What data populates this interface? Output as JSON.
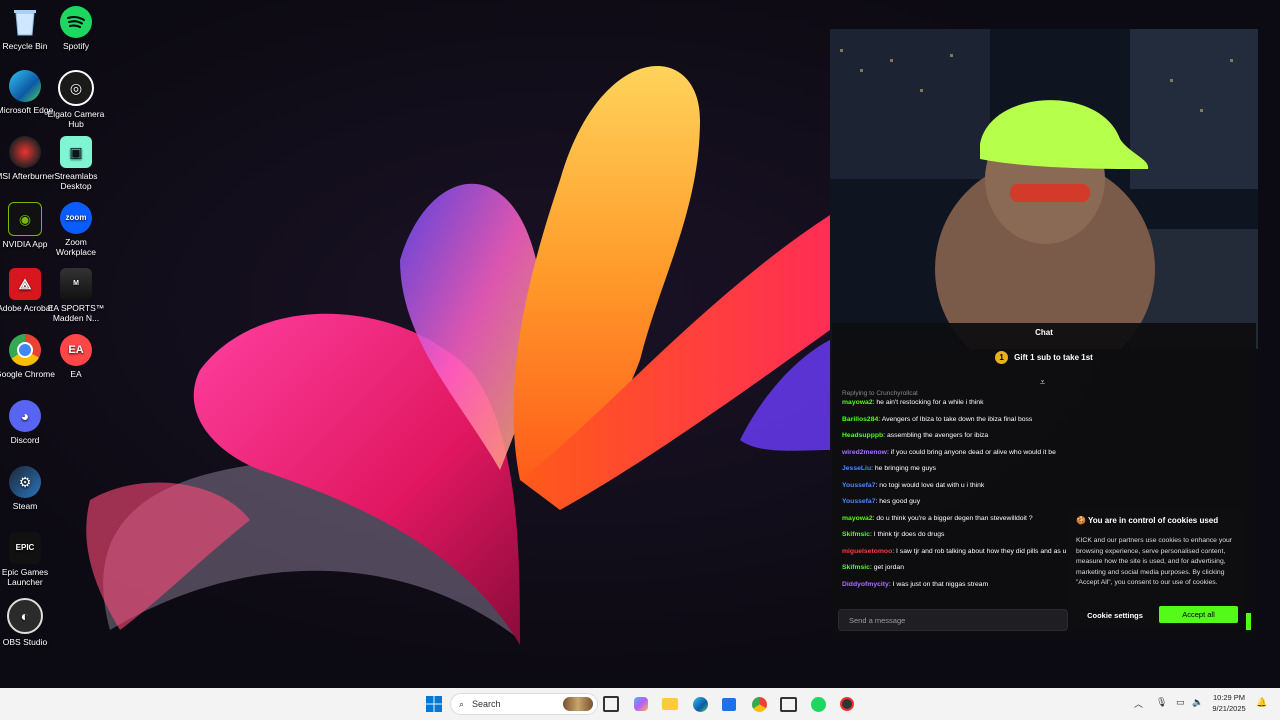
{
  "desktop": {
    "icons": [
      {
        "label": "Recycle Bin"
      },
      {
        "label": "Spotify"
      },
      {
        "label": "Microsoft Edge"
      },
      {
        "label": "Elgato Camera Hub"
      },
      {
        "label": "MSI Afterburner"
      },
      {
        "label": "Streamlabs Desktop"
      },
      {
        "label": "NVIDIA App"
      },
      {
        "label": "Zoom Workplace"
      },
      {
        "label": "Adobe Acrobat"
      },
      {
        "label": "EA SPORTS™ Madden N..."
      },
      {
        "label": "Google Chrome"
      },
      {
        "label": "EA"
      },
      {
        "label": "Discord"
      },
      {
        "label": "Steam"
      },
      {
        "label": "Epic Games Launcher"
      },
      {
        "label": "OBS Studio"
      }
    ]
  },
  "chat": {
    "title": "Chat",
    "pinned": "Gift 1 sub to take 1st",
    "reply_note": "Replying to Crunchyrollcat",
    "messages": [
      {
        "user": "mayowa2",
        "color": "#53fc18",
        "text": "he ain't restocking for a while i think"
      },
      {
        "user": "Barillos284",
        "color": "#53fc18",
        "text": "Avengers of Ibiza to take down the ibiza final boss"
      },
      {
        "user": "Headsupppb",
        "color": "#53fc18",
        "text": "assembling the avengers for ibiza"
      },
      {
        "user": "wired2menow",
        "color": "#a970ff",
        "text": "if you could bring anyone dead or alive who would it be"
      },
      {
        "user": "JesseLiu",
        "color": "#4a8cff",
        "text": "he bringing me guys"
      },
      {
        "user": "Youssefa7",
        "color": "#4a8cff",
        "text": "no togi would love dat with u i think"
      },
      {
        "user": "Youssefa7",
        "color": "#4a8cff",
        "text": "hes good guy"
      },
      {
        "user": "mayowa2",
        "color": "#53fc18",
        "text": "do u think you're a bigger degen than stevewilldoit ?"
      },
      {
        "user": "Skifmsic",
        "color": "#53fc18",
        "text": "I think tjr does do drugs"
      },
      {
        "user": "miguelsetomoo",
        "color": "#ff3b3b",
        "text": "I saw tjr and rob talking about how they did pills and as u"
      },
      {
        "user": "Skifmsic",
        "color": "#53fc18",
        "text": "get jordan"
      },
      {
        "user": "Diddyofmycity",
        "color": "#a970ff",
        "text": "I was just on that niggas stream"
      }
    ],
    "send_placeholder": "Send a message"
  },
  "cookie": {
    "title": "You are in control of cookies used",
    "body": "KICK and our partners use cookies to enhance your browsing experience, serve personalised content, measure how the site is used, and for advertising, marketing and social media purposes. By clicking \"Accept All\", you consent to our use of cookies.",
    "settings_label": "Cookie settings",
    "accept_label": "Accept all"
  },
  "taskbar": {
    "search_label": "Search",
    "time": "10:29 PM",
    "date": "9/21/2025"
  },
  "colors": {
    "kick_green": "#53fc18",
    "taskbar_bg": "#f3f3f3"
  }
}
